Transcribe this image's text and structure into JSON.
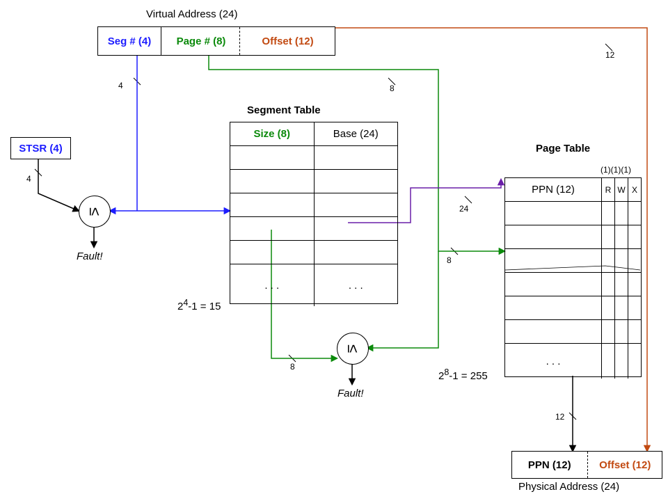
{
  "title": "Virtual Address (24)",
  "va": {
    "seg": "Seg # (4)",
    "page": "Page # (8)",
    "offset": "Offset (12)"
  },
  "stsr": "STSR (4)",
  "fault1": "Fault!",
  "fault2": "Fault!",
  "segtable": {
    "title": "Segment Table",
    "size": "Size (8)",
    "base": "Base (24)",
    "dots1": ". . .",
    "dots2": ". . .",
    "maxidx_a": "2",
    "maxidx_b": "4",
    "maxidx_c": "-1 = 15"
  },
  "pagetable": {
    "title": "Page Table",
    "ppn": "PPN (12)",
    "r": "R",
    "w": "W",
    "x": "X",
    "bits": "(1)(1)(1)",
    "dots": ". . .",
    "maxidx_a": "2",
    "maxidx_b": "8",
    "maxidx_c": "-1 = 255"
  },
  "pa": {
    "ppn": "PPN (12)",
    "offset": "Offset (12)",
    "title": "Physical Address (24)"
  },
  "wires": {
    "w4a": "4",
    "w4b": "4",
    "w8a": "8",
    "w8b": "8",
    "w8c": "8",
    "w12a": "12",
    "w12b": "12",
    "w24": "24"
  },
  "le1": "≤",
  "le2": "≤"
}
